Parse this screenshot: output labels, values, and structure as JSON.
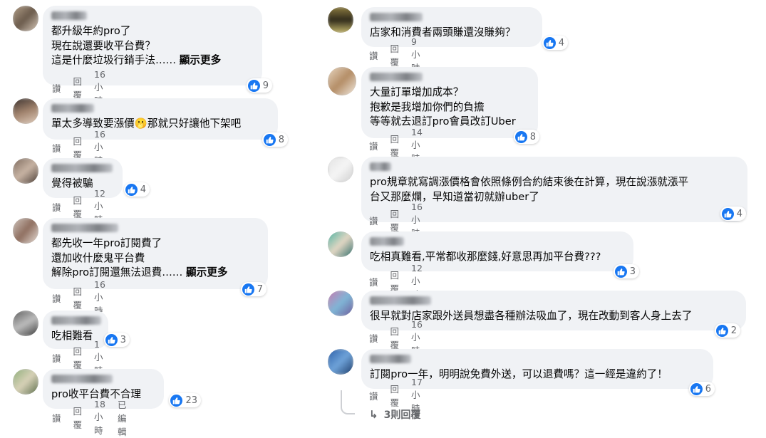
{
  "actions": {
    "like": "讚",
    "reply": "回覆",
    "edited": "已編輯"
  },
  "left": [
    {
      "text": "都升級年約pro了\n現在說還要收平台費？\n這是什麼垃圾行銷手法……",
      "more": "顯示更多",
      "likes": "9",
      "time": "16小時"
    },
    {
      "text": "單太多導致要漲價🫢那就只好讓他下架吧",
      "likes": "8",
      "time": "16小時"
    },
    {
      "text": "覺得被騙",
      "likes": "4",
      "time": "12小時"
    },
    {
      "text": "都先收一年pro訂閱費了\n還加收什麼鬼平台費\n解除pro訂閱還無法退費……",
      "more": "顯示更多",
      "likes": "7",
      "time": "16小時"
    },
    {
      "text": "吃相難看",
      "likes": "3",
      "time": "1小時"
    },
    {
      "text": "pro收平台費不合理",
      "likes": "23",
      "time": "18小時",
      "edited": true
    }
  ],
  "right": [
    {
      "text": "店家和消費者兩頭賺還沒賺夠？",
      "likes": "4",
      "time": "9小時"
    },
    {
      "text": "大量訂單增加成本？\n抱歉是我增加你們的負擔\n等等就去退訂pro會員改訂Uber",
      "likes": "8",
      "time": "14小時"
    },
    {
      "text": "pro規章就寫調漲價格會依照條例合約結束後在計算，現在說漲就漲平\n台又那麼爛，早知道當初就辦uber了",
      "likes": "4",
      "time": "16小時"
    },
    {
      "text": "吃相真難看,平常都收那麼錢,好意思再加平台費???",
      "likes": "3",
      "time": "12小時"
    },
    {
      "text": "很早就對店家跟外送員想盡各種辦法吸血了，現在改動到客人身上去了",
      "likes": "2",
      "time": "16小時"
    },
    {
      "text": "訂閱pro一年，明明說免費外送，可以退費嗎？這一經是違約了！",
      "likes": "6",
      "time": "17小時"
    }
  ],
  "view_replies": "3則回覆",
  "colors": {
    "bubble": "#f0f2f5",
    "like_blue": "#1877f2",
    "meta_gray": "#65676b"
  }
}
